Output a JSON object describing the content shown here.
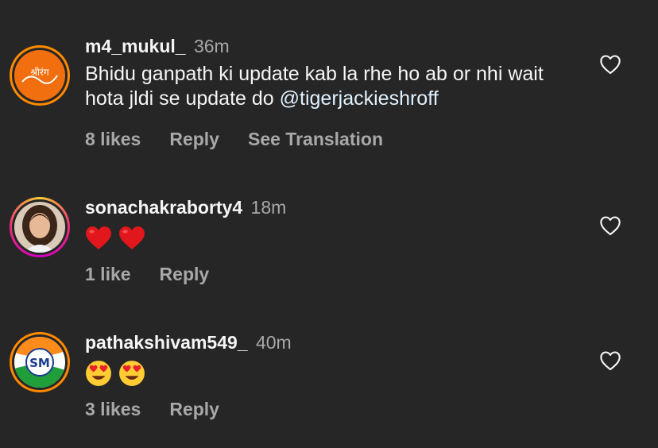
{
  "comments": [
    {
      "username": "m4_mukul_",
      "time": "36m",
      "text_main": "Bhidu ganpath ki update kab la rhe ho ab or nhi wait hota jldi se update do ",
      "mention": "@tigerjackieshroff",
      "likes": "8 likes",
      "reply": "Reply",
      "translate": "See Translation",
      "avatar_text": "श्रीरंग"
    },
    {
      "username": "sonachakraborty4",
      "time": "18m",
      "emojis": [
        "red-heart",
        "red-heart"
      ],
      "likes": "1 like",
      "reply": "Reply"
    },
    {
      "username": "pathakshivam549_",
      "time": "40m",
      "emojis": [
        "heart-eyes",
        "heart-eyes"
      ],
      "likes": "3 likes",
      "reply": "Reply",
      "avatar_text": "SM"
    }
  ],
  "colors": {
    "background": "#262626",
    "text": "#f5f5f5",
    "muted": "#a8a8a8",
    "mention": "#e0f1ff"
  }
}
